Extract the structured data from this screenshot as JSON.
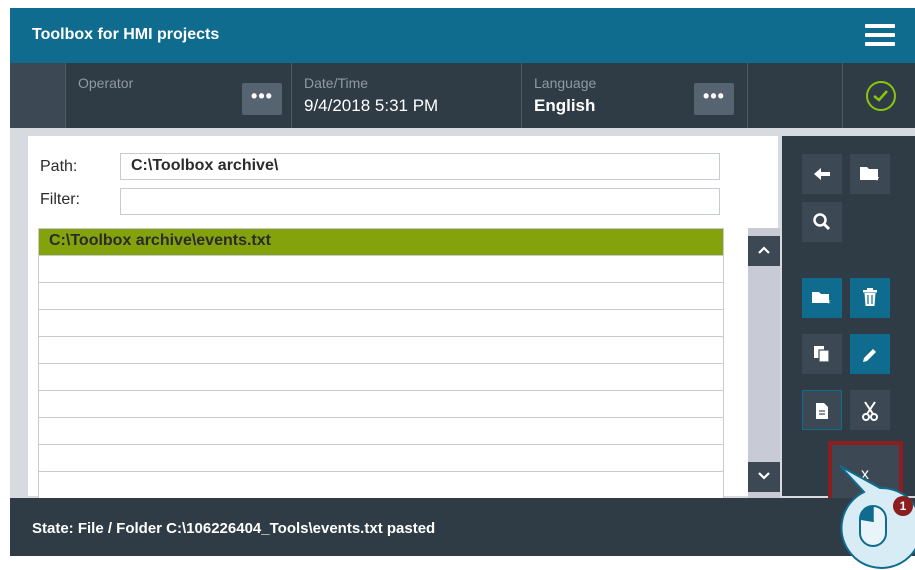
{
  "app": {
    "title": "Toolbox for HMI projects"
  },
  "header": {
    "operator_label": "Operator",
    "operator_value": "",
    "operator_button": "•••",
    "datetime_label": "Date/Time",
    "datetime_value": "9/4/2018 5:31 PM",
    "language_label": "Language",
    "language_value": "English",
    "language_button": "•••"
  },
  "form": {
    "path_label": "Path:",
    "path_value": "C:\\Toolbox archive\\",
    "filter_label": "Filter:",
    "filter_value": ""
  },
  "file_list": [
    {
      "name": "C:\\Toolbox archive\\events.txt",
      "selected": true
    },
    {
      "name": ""
    },
    {
      "name": ""
    },
    {
      "name": ""
    },
    {
      "name": ""
    },
    {
      "name": ""
    },
    {
      "name": ""
    },
    {
      "name": ""
    },
    {
      "name": ""
    },
    {
      "name": ""
    }
  ],
  "toolbar": {
    "close_label": "x"
  },
  "callout": {
    "step": "1"
  },
  "status": {
    "text": "State: File / Folder C:\\106226404_Tools\\events.txt pasted"
  },
  "colors": {
    "accent": "#0f6c8e",
    "selection": "#84a20c",
    "dark": "#2f3b45",
    "ok": "#8bc50d",
    "highlight": "#8b1e1e"
  }
}
